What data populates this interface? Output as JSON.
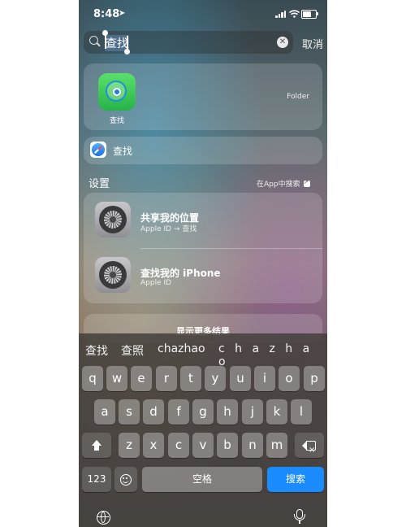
{
  "status_bar": {
    "time": "8:48",
    "location_glyph": "➤"
  },
  "search": {
    "query": "查找",
    "cancel_label": "取消",
    "clear_glyph": "✕"
  },
  "top_hit": {
    "app_name": "查找",
    "kind_label": "Folder"
  },
  "safari_suggestion": {
    "label": "查找"
  },
  "settings_section": {
    "title": "设置",
    "search_in_app_label": "在App中搜索",
    "rows": [
      {
        "title": "共享我的位置",
        "subtitle": "Apple ID → 查找"
      },
      {
        "title": "查找我的 iPhone",
        "subtitle": "Apple ID"
      }
    ]
  },
  "show_more": {
    "label": "显示更多结果"
  },
  "keyboard": {
    "candidates": [
      "查找",
      "查照",
      "chazhao",
      "c h a z h a o"
    ],
    "row1": [
      "q",
      "w",
      "e",
      "r",
      "t",
      "y",
      "u",
      "i",
      "o",
      "p"
    ],
    "row2": [
      "a",
      "s",
      "d",
      "f",
      "g",
      "h",
      "j",
      "k",
      "l"
    ],
    "row3": [
      "z",
      "x",
      "c",
      "v",
      "b",
      "n",
      "m"
    ],
    "numbers_label": "123",
    "space_label": "空格",
    "search_label": "搜索"
  },
  "colors": {
    "accent_blue": "#1a8cff",
    "find_my_green": "#27b34a"
  }
}
